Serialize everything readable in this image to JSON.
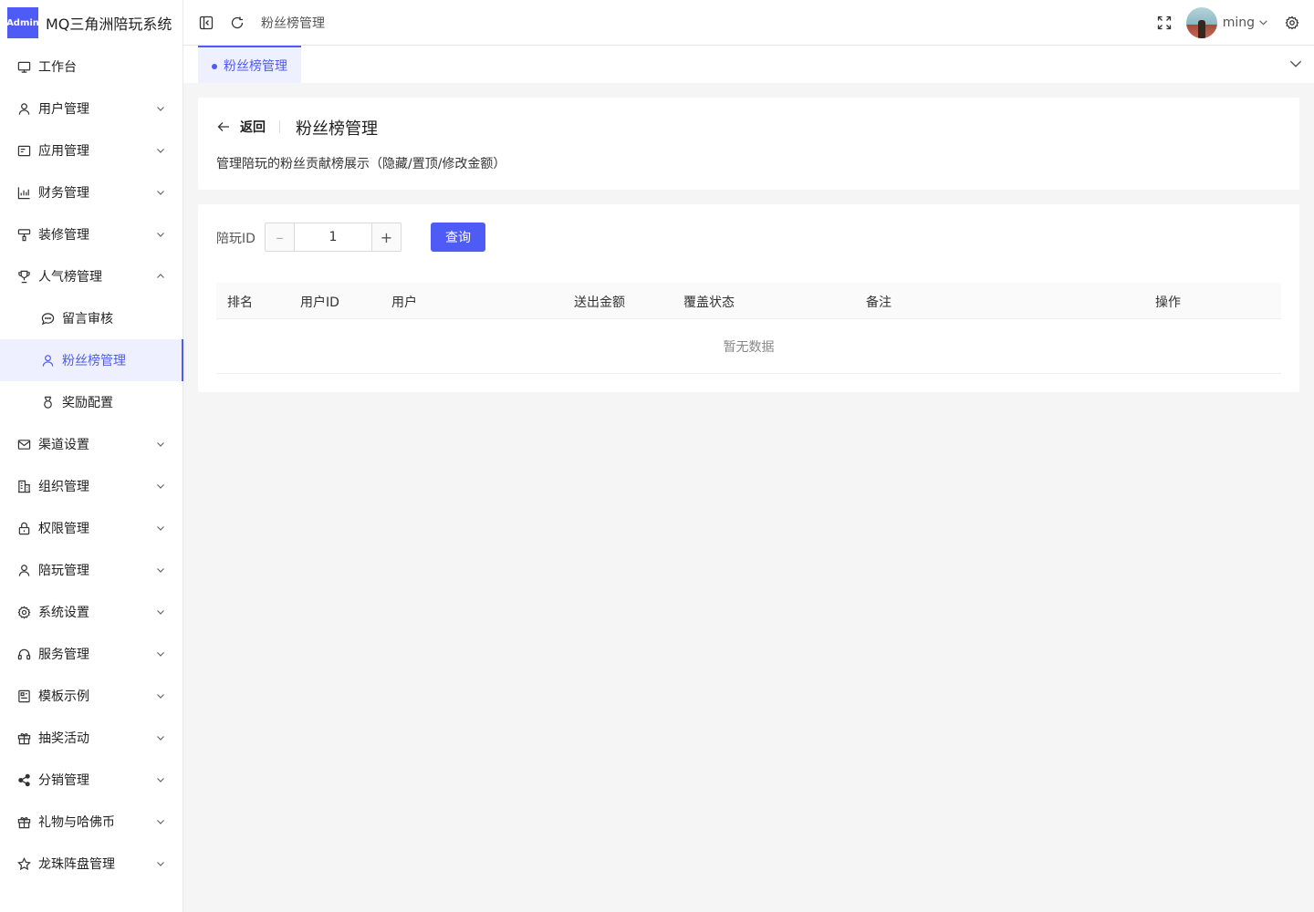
{
  "brand": {
    "logo_text": "Admin",
    "title": "MQ三角洲陪玩系统"
  },
  "sidebar": {
    "items": [
      {
        "label": "工作台",
        "icon": "monitor-icon"
      },
      {
        "label": "用户管理",
        "icon": "user-icon"
      },
      {
        "label": "应用管理",
        "icon": "app-icon"
      },
      {
        "label": "财务管理",
        "icon": "bar-chart-icon"
      },
      {
        "label": "装修管理",
        "icon": "paint-icon"
      },
      {
        "label": "人气榜管理",
        "icon": "trophy-icon",
        "expanded": true,
        "children": [
          {
            "label": "留言审核",
            "icon": "comment-icon"
          },
          {
            "label": "粉丝榜管理",
            "icon": "user-icon",
            "active": true
          },
          {
            "label": "奖励配置",
            "icon": "medal-icon"
          }
        ]
      },
      {
        "label": "渠道设置",
        "icon": "mail-icon"
      },
      {
        "label": "组织管理",
        "icon": "building-icon"
      },
      {
        "label": "权限管理",
        "icon": "lock-icon"
      },
      {
        "label": "陪玩管理",
        "icon": "user-icon"
      },
      {
        "label": "系统设置",
        "icon": "gear-icon"
      },
      {
        "label": "服务管理",
        "icon": "headset-icon"
      },
      {
        "label": "模板示例",
        "icon": "template-icon"
      },
      {
        "label": "抽奖活动",
        "icon": "gift-icon"
      },
      {
        "label": "分销管理",
        "icon": "share-icon"
      },
      {
        "label": "礼物与哈佛币",
        "icon": "gift-icon"
      },
      {
        "label": "龙珠阵盘管理",
        "icon": "star-icon"
      }
    ]
  },
  "header": {
    "breadcrumb": "粉丝榜管理",
    "username": "ming"
  },
  "tabs": [
    {
      "label": "粉丝榜管理",
      "active": true
    }
  ],
  "page": {
    "back_label": "返回",
    "title": "粉丝榜管理",
    "description": "管理陪玩的粉丝贡献榜展示（隐藏/置顶/修改金额）"
  },
  "filter": {
    "label": "陪玩ID",
    "value": "1",
    "query_label": "查询"
  },
  "table": {
    "columns": [
      "排名",
      "用户ID",
      "用户",
      "送出金额",
      "覆盖状态",
      "备注",
      "操作"
    ],
    "rows": [],
    "empty_text": "暂无数据"
  },
  "colors": {
    "accent": "#4f5bf5",
    "active_bg": "#eef0ff"
  }
}
